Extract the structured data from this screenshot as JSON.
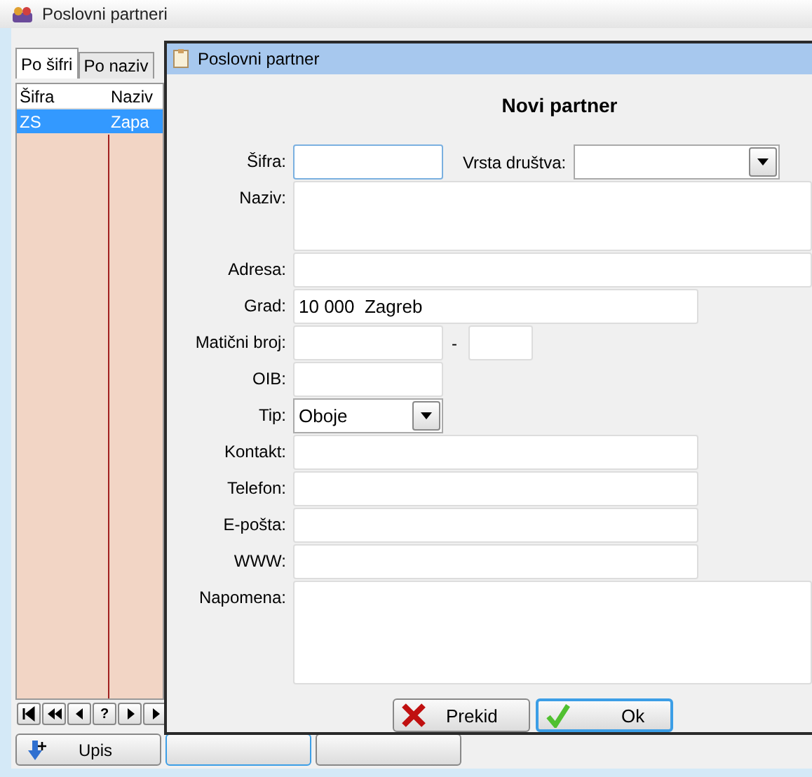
{
  "window": {
    "title": "Poslovni partneri"
  },
  "tabs": [
    {
      "label": "Po šifri",
      "selected": true
    },
    {
      "label": "Po naziv",
      "selected": false
    }
  ],
  "table": {
    "columns": [
      "Šifra",
      "Naziv"
    ],
    "rows": [
      {
        "cells": [
          "ZS",
          "Zapa"
        ],
        "selected": true
      }
    ]
  },
  "navigator": [
    {
      "kind": "first"
    },
    {
      "kind": "prev-page"
    },
    {
      "kind": "prev"
    },
    {
      "kind": "text",
      "label": "?"
    },
    {
      "kind": "next"
    },
    {
      "kind": "next"
    }
  ],
  "bottom_buttons": [
    {
      "kind": "add",
      "label": "Upis",
      "focused": false
    },
    {
      "kind": "covered",
      "focused": true
    },
    {
      "kind": "covered",
      "focused": false
    }
  ],
  "dialog": {
    "title": "Poslovni partner",
    "heading": "Novi partner",
    "fields": [
      {
        "kind": "short",
        "label": "Šifra:",
        "focused": true,
        "extra": {
          "label": "Vrsta društva:"
        }
      },
      {
        "kind": "memo",
        "label": "Naziv:"
      },
      {
        "kind": "wide",
        "label": "Adresa:"
      },
      {
        "kind": "medium",
        "label": "Grad:",
        "value": "10 000  Zagreb"
      },
      {
        "kind": "pair",
        "label": "Matični broj:",
        "separator": "-"
      },
      {
        "kind": "short",
        "label": "OIB:"
      },
      {
        "kind": "combo",
        "label": "Tip:",
        "value": "Oboje"
      },
      {
        "kind": "medium",
        "label": "Kontakt:"
      },
      {
        "kind": "medium",
        "label": "Telefon:"
      },
      {
        "kind": "medium",
        "label": "E-pošta:"
      },
      {
        "kind": "medium",
        "label": "WWW:"
      },
      {
        "kind": "note",
        "label": "Napomena:"
      }
    ],
    "buttons": [
      {
        "kind": "cancel",
        "label": "Prekid",
        "focused": false
      },
      {
        "kind": "ok",
        "label": "Ok",
        "focused": true
      }
    ]
  }
}
